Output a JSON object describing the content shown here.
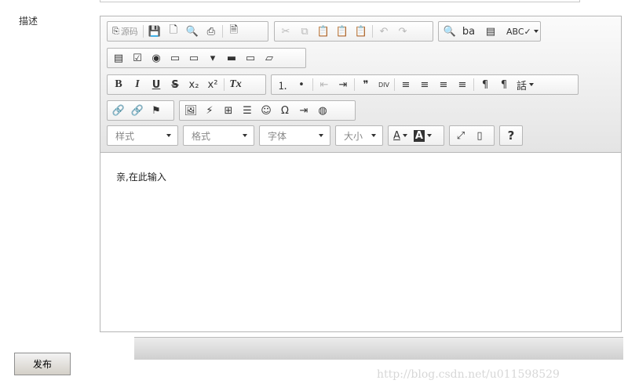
{
  "form": {
    "label": "描述",
    "publish_label": "发布"
  },
  "editor": {
    "content": "亲,在此输入",
    "source_label": "源码",
    "combos": {
      "style": "样式",
      "format": "格式",
      "font": "字体",
      "size": "大小"
    },
    "icons": {
      "source": "⎘",
      "save": "💾",
      "newpage": "🗋",
      "preview": "🔍",
      "print": "⎙",
      "templates": "🗎",
      "cut": "✂",
      "copy": "⧉",
      "paste": "📋",
      "paste_text": "📋",
      "paste_word": "📋",
      "undo": "↶",
      "redo": "↷",
      "find": "🔍",
      "replace": "ba",
      "select_all": "▤",
      "spell": "ABC✓",
      "form": "▤",
      "checkbox": "☑",
      "radio": "◉",
      "textfield": "▭",
      "textarea": "▭",
      "select": "▾",
      "button": "▬",
      "imagebutton": "▭",
      "hidden": "▱",
      "bold": "B",
      "italic": "I",
      "underline": "U",
      "strike": "S",
      "subscript": "x₂",
      "superscript": "x²",
      "removeformat": "Tx",
      "numlist": "⒈",
      "bullist": "•",
      "outdent": "⇤",
      "indent": "⇥",
      "blockquote": "❞",
      "div": "DIV",
      "align_left": "≡",
      "align_center": "≡",
      "align_right": "≡",
      "align_justify": "≡",
      "ltr": "¶",
      "rtl": "¶",
      "language": "話",
      "link": "🔗",
      "unlink": "🔗",
      "anchor": "⚑",
      "image": "🖼",
      "flash": "⚡",
      "table": "⊞",
      "hr": "☰",
      "smiley": "☺",
      "specialchar": "Ω",
      "pagebreak": "⇥",
      "iframe": "◍",
      "textcolor": "A",
      "bgcolor": "A",
      "maximize": "⤢",
      "showblocks": "▯",
      "about": "?"
    }
  },
  "watermark": "http://blog.csdn.net/u011598529"
}
